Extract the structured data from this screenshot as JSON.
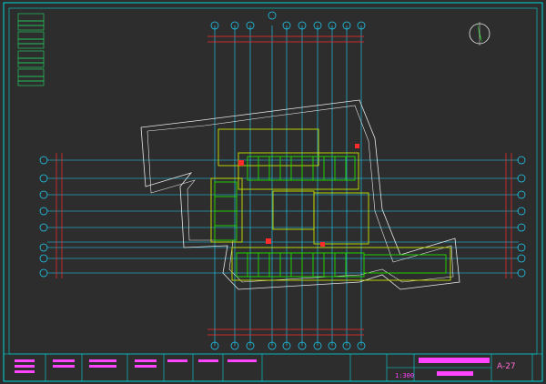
{
  "drawing": {
    "sheet_number": "A-27",
    "scale_note": "1:300",
    "colors": {
      "background": "#2d2d2d",
      "border": "#00d8d8",
      "grid": "#1fd6ff",
      "building": "#c8e000",
      "walls": "#23d000",
      "site": "#e8e8e8",
      "dims": "#ff2b2b",
      "annot": "#ff44ff"
    },
    "icons": [
      "north-arrow-icon",
      "grid-bubble-icon"
    ]
  }
}
